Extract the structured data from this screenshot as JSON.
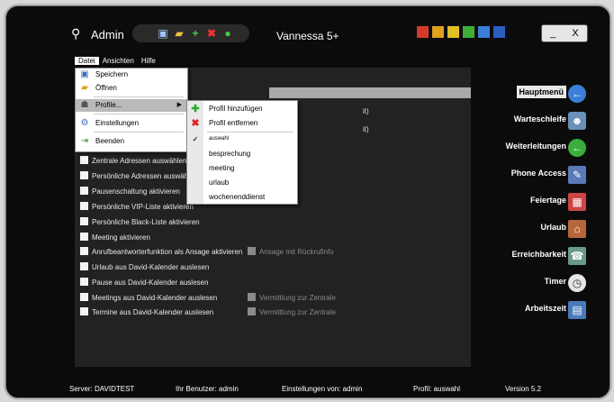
{
  "app": {
    "title": "Admin",
    "window_title": "Vannessa 5+"
  },
  "toolbar": {
    "icons": [
      "save-icon",
      "folder-icon",
      "add-icon",
      "delete-icon",
      "refresh-icon"
    ]
  },
  "color_swatches": [
    "#d63a2a",
    "#e0a020",
    "#e0c020",
    "#3fae3a",
    "#3a7fd8",
    "#2a5fc0"
  ],
  "window_controls": {
    "minimize": "_",
    "close": "X"
  },
  "menubar": [
    "Datei",
    "Ansichten",
    "Hilfe"
  ],
  "file_menu": {
    "items": [
      {
        "label": "Speichern",
        "icon": "save-icon"
      },
      {
        "label": "Öffnen",
        "icon": "folder-icon"
      },
      {
        "label": "Profile...",
        "icon": "profile-icon"
      },
      {
        "label": "Einstellungen",
        "icon": "settings-icon"
      },
      {
        "label": "Beenden",
        "icon": "exit-icon"
      }
    ]
  },
  "profile_submenu": {
    "add": "Profil hinzufügen",
    "remove": "Profil entfernen",
    "choose": "auswahl",
    "profiles": [
      "besprechung",
      "meeting",
      "urlaub",
      "wochenenddienst"
    ]
  },
  "content_peek": [
    "it)",
    "it)"
  ],
  "options": [
    {
      "label": "Zentrale Adressen auswählen",
      "checked": false
    },
    {
      "label": "Persönliche Adressen auswählen",
      "checked": false
    },
    {
      "label": "Pausenschaltung aktivieren",
      "checked": false
    },
    {
      "label": "Persönliche VIP-Liste aktivieren",
      "checked": false
    },
    {
      "label": "Persönliche Black-Liste aktivieren",
      "checked": false
    },
    {
      "label": "Meeting aktivieren",
      "checked": false
    },
    {
      "label": "Anrufbeantworterfunktion als Ansage aktivieren",
      "checked": false,
      "extra": "Ansage mit Rückrufinfo"
    },
    {
      "label": "Urlaub aus David-Kalender auslesen",
      "checked": false
    },
    {
      "label": "Pause aus David-Kalender auslesen",
      "checked": false
    },
    {
      "label": "Meetings aus David-Kalender auslesen",
      "checked": false,
      "extra": "Vermittlung zur Zentrale"
    },
    {
      "label": "Termine aus David-Kalender auslesen",
      "checked": false,
      "extra": "Vermittlung zur Zentrale"
    }
  ],
  "nav": [
    {
      "label": "Hauptmenü",
      "icon": "back-arrow-icon",
      "active": true
    },
    {
      "label": "Warteschleife",
      "icon": "people-icon"
    },
    {
      "label": "Weiterleitungen",
      "icon": "forward-arrow-icon"
    },
    {
      "label": "Phone Access",
      "icon": "phone-note-icon"
    },
    {
      "label": "Feiertage",
      "icon": "calendar-icon"
    },
    {
      "label": "Urlaub",
      "icon": "house-icon"
    },
    {
      "label": "Erreichbarkeit",
      "icon": "phone-icon"
    },
    {
      "label": "Timer",
      "icon": "clock-icon"
    },
    {
      "label": "Arbeitszeit",
      "icon": "document-icon"
    }
  ],
  "status": {
    "server": "Server: DAVIDTEST",
    "user": "Ihr Benutzer: admin",
    "settings_of": "Einstellungen von: admin",
    "profile": "Profil: auswahl",
    "version": "Version 5.2"
  }
}
